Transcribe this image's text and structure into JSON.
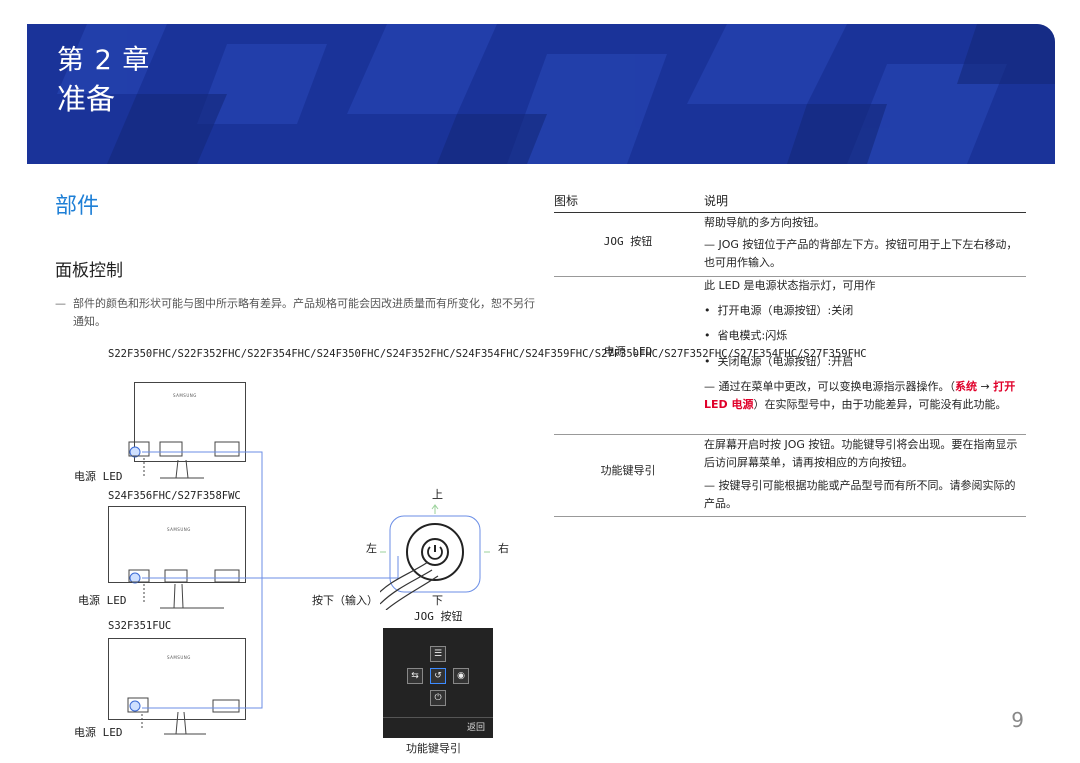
{
  "header": {
    "chapter_line": "第 2 章",
    "chapter_title": "准备"
  },
  "section": {
    "title": "部件",
    "subsection": "面板控制",
    "note": "部件的颜色和形状可能与图中所示略有差异。产品规格可能会因改进质量而有所变化，恕不另行通知。",
    "note_dash": "—"
  },
  "figure": {
    "models_group1": "S22F350FHC/S22F352FHC/S22F354FHC/S24F350FHC/S24F352FHC/S24F354FHC/S24F359FHC/S27F350FHC/S27F352FHC/S27F354FHC/S27F359FHC",
    "models_group2": "S24F356FHC/S27F358FWC",
    "models_group3": "S32F351FUC",
    "power_led": "电源 LED",
    "brand": "SAMSUNG",
    "up": "上",
    "down": "下",
    "left": "左",
    "right": "右",
    "press": "按下（输入）",
    "jog_button": "JOG 按钮",
    "function_guide": "功能键导引",
    "fg_back": "返回"
  },
  "table": {
    "col_icon": "图标",
    "col_desc": "说明",
    "rows": [
      {
        "icon": "JOG 按钮",
        "desc": "帮助导航的多方向按钮。",
        "note": "JOG 按钮位于产品的背部左下方。按钮可用于上下左右移动，也可用作输入。"
      },
      {
        "icon": "电源 LED",
        "desc": "此 LED 是电源状态指示灯，可用作",
        "bullets": [
          "打开电源（电源按钮）:关闭",
          "省电模式:闪烁",
          "关闭电源（电源按钮）:开启"
        ],
        "note_pre": "通过在菜单中更改，可以变换电源指示器操作。（",
        "note_link1": "系统",
        "note_arrow": " → ",
        "note_link2": "打开 LED 电源",
        "note_post": "）在实际型号中，由于功能差异，可能没有此功能。"
      },
      {
        "icon": "功能键导引",
        "desc": "在屏幕开启时按 JOG 按钮。功能键导引将会出现。要在指南显示后访问屏幕菜单，请再按相应的方向按钮。",
        "note": "按键导引可能根据功能或产品型号而有所不同。请参阅实际的产品。"
      }
    ]
  },
  "page_number": "9",
  "colors": {
    "banner": "#1a3399",
    "accent_blue": "#1e7fd6",
    "link_red": "#e0002a"
  }
}
